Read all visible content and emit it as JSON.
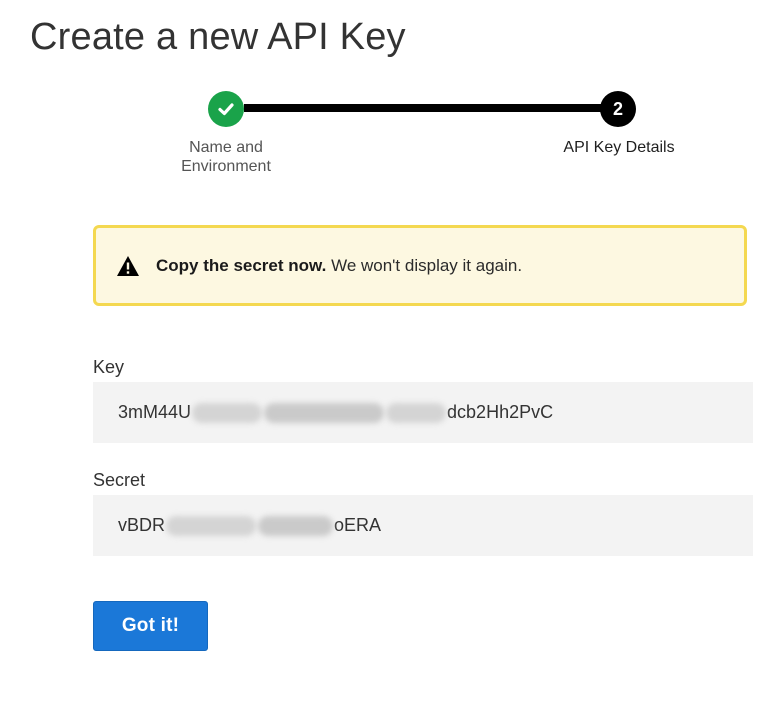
{
  "page": {
    "title": "Create a new API Key"
  },
  "stepper": {
    "steps": [
      {
        "label_line1": "Name and",
        "label_line2": "Environment",
        "status": "completed",
        "icon": "checkmark-icon"
      },
      {
        "number": "2",
        "label": "API Key Details",
        "status": "current"
      }
    ],
    "colors": {
      "completed": "#1aa34a",
      "current": "#000000",
      "line": "#000000"
    }
  },
  "warning": {
    "icon": "warning-triangle-icon",
    "bold_text": "Copy the secret now.",
    "text": " We won't display it again.",
    "background": "#fdf8e1",
    "border": "#f4d850"
  },
  "key_field": {
    "label": "Key",
    "value_visible_start": "3mM44U",
    "value_visible_end": "dcb2Hh2PvC",
    "obscured": true
  },
  "secret_field": {
    "label": "Secret",
    "value_visible_start": "vBDR",
    "value_visible_end": "oERA",
    "obscured": true
  },
  "actions": {
    "got_it_label": "Got it!",
    "accent": "#1b78d8"
  }
}
